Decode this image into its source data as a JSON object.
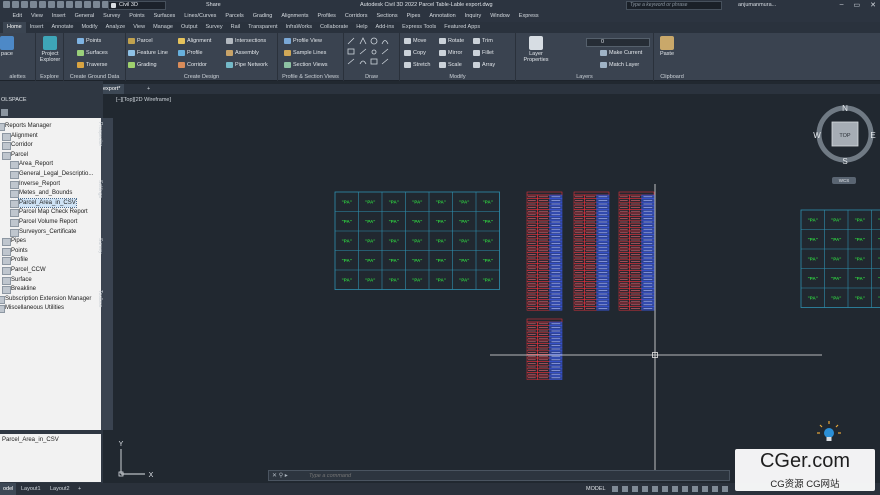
{
  "titlebar": {
    "workspace": "Civil 3D",
    "share": "Share",
    "document_title": "Autodesk Civil 3D 2022   Parcel Table-Lable export.dwg",
    "search_placeholder": "Type a keyword or phrase",
    "user": "anjumanmura..."
  },
  "menubar": [
    "Edit",
    "View",
    "Insert",
    "General",
    "Survey",
    "Points",
    "Surfaces",
    "Lines/Curves",
    "Parcels",
    "Grading",
    "Alignments",
    "Profiles",
    "Corridors",
    "Sections",
    "Pipes",
    "Annotation",
    "Inquiry",
    "Window",
    "Express"
  ],
  "tabs": [
    {
      "label": "Home",
      "active": true
    },
    {
      "label": "Insert"
    },
    {
      "label": "Annotate"
    },
    {
      "label": "Modify"
    },
    {
      "label": "Analyze"
    },
    {
      "label": "View"
    },
    {
      "label": "Manage"
    },
    {
      "label": "Output"
    },
    {
      "label": "Survey"
    },
    {
      "label": "Rail"
    },
    {
      "label": "Transparent"
    },
    {
      "label": "InfraWorks"
    },
    {
      "label": "Collaborate"
    },
    {
      "label": "Help"
    },
    {
      "label": "Add-ins"
    },
    {
      "label": "Express Tools"
    },
    {
      "label": "Featured Apps"
    }
  ],
  "ribbon": {
    "palettes": {
      "space": "pace",
      "label": "alettes"
    },
    "explore": {
      "button": "Project Explorer",
      "label": "Explore"
    },
    "ground": {
      "points": "Points",
      "surfaces": "Surfaces",
      "traverse": "Traverse",
      "label": "Create Ground Data"
    },
    "design": {
      "parcel": "Parcel",
      "feature_line": "Feature Line",
      "grading": "Grading",
      "alignment": "Alignment",
      "profile": "Profile",
      "corridor": "Corridor",
      "intersections": "Intersections",
      "assembly": "Assembly",
      "pipe_network": "Pipe Network",
      "label": "Create Design"
    },
    "profile_section": {
      "profile_view": "Profile View",
      "sample_lines": "Sample Lines",
      "section_views": "Section Views",
      "label": "Profile & Section Views"
    },
    "draw": {
      "label": "Draw"
    },
    "modify": {
      "move": "Move",
      "rotate": "Rotate",
      "trim": "Trim",
      "copy": "Copy",
      "mirror": "Mirror",
      "fillet": "Fillet",
      "stretch": "Stretch",
      "scale": "Scale",
      "array": "Array",
      "label": "Modify"
    },
    "layers": {
      "layer_properties": "Layer Properties",
      "current_layer": "0",
      "make_current": "Make Current",
      "match_layer": "Match Layer",
      "label": "Layers"
    },
    "clipboard": {
      "paste": "Paste",
      "label": "Clipboard"
    }
  },
  "doc_tabs": [
    {
      "label": "tart"
    },
    {
      "label": "Parcel Table-Lable export*",
      "active": true
    },
    {
      "label": "+"
    }
  ],
  "toolspace": {
    "header": "OLSPACE",
    "tree": [
      {
        "label": "Reports Manager",
        "level": 0
      },
      {
        "label": "Alignment",
        "level": 1
      },
      {
        "label": "Corridor",
        "level": 1
      },
      {
        "label": "Parcel",
        "level": 1
      },
      {
        "label": "Area_Report",
        "level": 2
      },
      {
        "label": "General_Legal_Descriptio...",
        "level": 2
      },
      {
        "label": "Inverse_Report",
        "level": 2
      },
      {
        "label": "Metes_and_Bounds",
        "level": 2
      },
      {
        "label": "Parcel_Area_in_CSV",
        "level": 2,
        "selected": true
      },
      {
        "label": "Parcel Map Check Report",
        "level": 2
      },
      {
        "label": "Parcel Volume Report",
        "level": 2
      },
      {
        "label": "Surveyors_Certificate",
        "level": 2
      },
      {
        "label": "Pipes",
        "level": 1
      },
      {
        "label": "Points",
        "level": 1
      },
      {
        "label": "Profile",
        "level": 1
      },
      {
        "label": "Parcel_CCW",
        "level": 1
      },
      {
        "label": "Surface",
        "level": 1
      },
      {
        "label": "Breakline",
        "level": 1
      },
      {
        "label": "Subscription Extension Manager",
        "level": 0
      },
      {
        "label": "Miscellaneous Utilities",
        "level": 0
      }
    ],
    "side_tabs": [
      "Prospector",
      "Settings",
      "Survey",
      "Toolbox"
    ],
    "preview": "Parcel_Area_in_CSV"
  },
  "viewport": {
    "label": "[–][Top][2D Wireframe]",
    "compass": {
      "n": "N",
      "s": "S",
      "e": "E",
      "w": "W",
      "face": "TOP"
    },
    "wcs": "WCS",
    "parcel_tag": "\"PA\"",
    "ucs_x": "X",
    "ucs_y": "Y"
  },
  "command_line": {
    "placeholder": "Type a command"
  },
  "statusbar": {
    "layouts": [
      {
        "label": "odel",
        "active": true
      },
      {
        "label": "Layout1"
      },
      {
        "label": "Layout2"
      },
      {
        "label": "+"
      }
    ],
    "model": "MODEL"
  },
  "watermark": {
    "line1": "CGer.com",
    "line2": "CG资源  CG网站"
  },
  "colors": {
    "grid_cyan": "#2f8fb0",
    "label_green": "#2ecc40",
    "table_red": "#e0303a",
    "table_blue": "#3a57e0",
    "crosshair": "#e8e8e8"
  }
}
